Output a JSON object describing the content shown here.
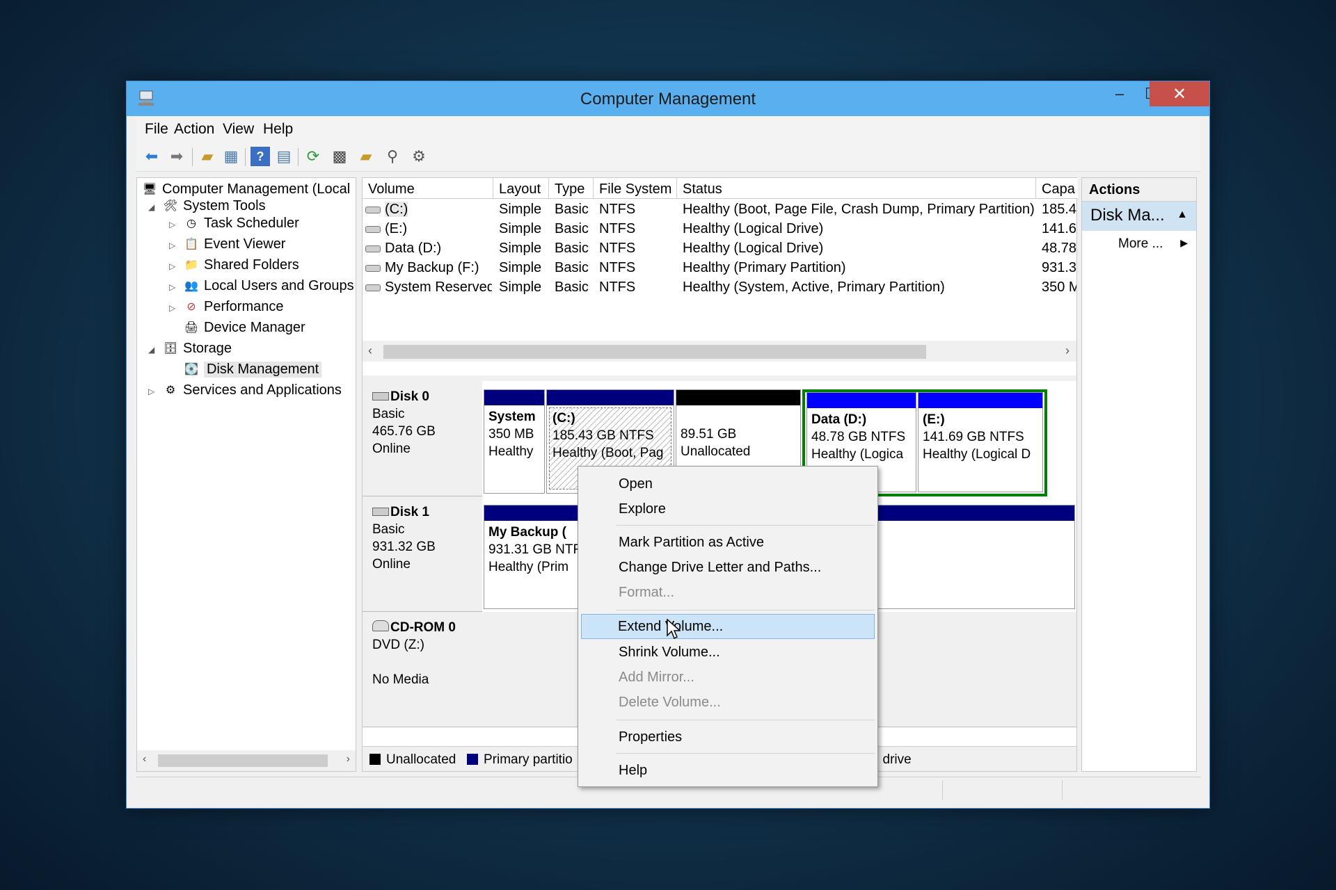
{
  "window": {
    "title": "Computer Management",
    "minimize": "–",
    "maximize": "☐",
    "close": "✕"
  },
  "menu": [
    "File",
    "Action",
    "View",
    "Help"
  ],
  "tree": {
    "root": "Computer Management (Local",
    "system_tools": "System Tools",
    "task_scheduler": "Task Scheduler",
    "event_viewer": "Event Viewer",
    "shared_folders": "Shared Folders",
    "local_users": "Local Users and Groups",
    "performance": "Performance",
    "device_manager": "Device Manager",
    "storage": "Storage",
    "disk_management": "Disk Management",
    "services": "Services and Applications"
  },
  "volume_list": {
    "headers": [
      "Volume",
      "Layout",
      "Type",
      "File System",
      "Status",
      "Capa"
    ],
    "rows": [
      [
        "(C:)",
        "Simple",
        "Basic",
        "NTFS",
        "Healthy (Boot, Page File, Crash Dump, Primary Partition)",
        "185.4"
      ],
      [
        "(E:)",
        "Simple",
        "Basic",
        "NTFS",
        "Healthy (Logical Drive)",
        "141.6"
      ],
      [
        "Data (D:)",
        "Simple",
        "Basic",
        "NTFS",
        "Healthy (Logical Drive)",
        "48.78"
      ],
      [
        "My Backup (F:)",
        "Simple",
        "Basic",
        "NTFS",
        "Healthy (Primary Partition)",
        "931.3"
      ],
      [
        "System Reserved",
        "Simple",
        "Basic",
        "NTFS",
        "Healthy (System, Active, Primary Partition)",
        "350 M"
      ]
    ]
  },
  "disks": {
    "disk0": {
      "name": "Disk 0",
      "type": "Basic",
      "size": "465.76 GB",
      "state": "Online"
    },
    "disk1": {
      "name": "Disk 1",
      "type": "Basic",
      "size": "931.32 GB",
      "state": "Online"
    },
    "cdrom": {
      "name": "CD-ROM 0",
      "type": "DVD (Z:)",
      "state": "No Media"
    }
  },
  "partitions": {
    "sysres": {
      "name": "System",
      "size": "350 MB",
      "status": "Healthy"
    },
    "c": {
      "name": "(C:)",
      "size": "185.43 GB NTFS",
      "status": "Healthy (Boot, Pag"
    },
    "unalloc": {
      "size": "89.51 GB",
      "status": "Unallocated"
    },
    "d": {
      "name": "Data (D:)",
      "size": "48.78 GB NTFS",
      "status": "Healthy (Logica"
    },
    "e": {
      "name": "(E:)",
      "size": "141.69 GB NTFS",
      "status": "Healthy (Logical D"
    },
    "f": {
      "name": "My Backup (",
      "size": "931.31 GB NTF",
      "status": "Healthy (Prim"
    }
  },
  "legend": {
    "unallocated": "Unallocated",
    "primary": "Primary partitio",
    "logical_tail": "l drive"
  },
  "actions": {
    "header": "Actions",
    "section": "Disk Ma...",
    "more": "More ..."
  },
  "context_menu": {
    "open": "Open",
    "explore": "Explore",
    "mark_active": "Mark Partition as Active",
    "change_letter": "Change Drive Letter and Paths...",
    "format": "Format...",
    "extend": "Extend Volume...",
    "shrink": "Shrink Volume...",
    "add_mirror": "Add Mirror...",
    "delete": "Delete Volume...",
    "properties": "Properties",
    "help": "Help"
  },
  "colors": {
    "primary": "#00007f",
    "logical": "#0000ff",
    "unallocated": "#000000",
    "extended": "#008000",
    "accent": "#5ab0ee"
  }
}
